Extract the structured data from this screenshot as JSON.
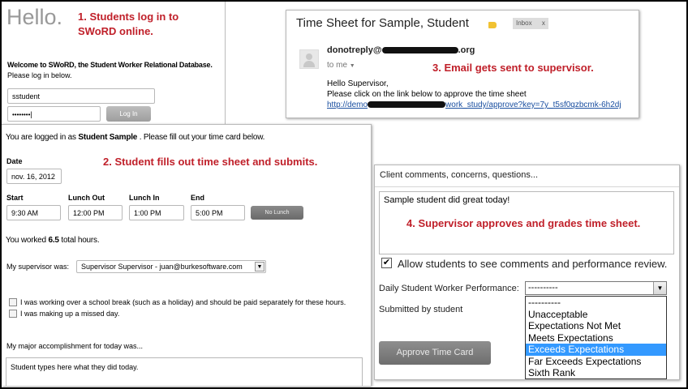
{
  "login": {
    "logo": "Hello.",
    "step": "1. Students log in to SWoRD online.",
    "welcome": "Welcome to SWoRD, the Student Worker Relational Database.",
    "instructions": "Please log in below.",
    "username_value": "sstudent",
    "password_value": "••••••••",
    "login_button": "Log In"
  },
  "email": {
    "subject": "Time Sheet for Sample, Student",
    "label": "Inbox",
    "label_close": "x",
    "sender": "donotreply@",
    "sender_domain": ".org",
    "to": "to me",
    "step": "3. Email gets sent to supervisor.",
    "greeting": "Hello Supervisor,",
    "body": "Please click on the link below to approve the time sheet",
    "link_start": "http://demo",
    "link_end": "work_study/approve?key=7y_t5sf0qzbcmk-6h2dj"
  },
  "timesheet": {
    "logged_in_prefix": "You are logged in as ",
    "student_name": "Student Sample",
    "logged_in_suffix": " . Please fill out your time card below.",
    "step": "2. Student fills out time sheet and submits.",
    "date_label": "Date",
    "date_value": "nov. 16, 2012",
    "start_label": "Start",
    "start_value": "9:30 AM",
    "lunch_out_label": "Lunch Out",
    "lunch_out_value": "12:00 PM",
    "lunch_in_label": "Lunch In",
    "lunch_in_value": "1:00 PM",
    "end_label": "End",
    "end_value": "5:00 PM",
    "no_lunch_button": "No Lunch",
    "worked_prefix": "You worked ",
    "worked_hours": "6.5",
    "worked_suffix": " total hours.",
    "supervisor_label": "My supervisor was:",
    "supervisor_value": "Supervisor Supervisor - juan@burkesoftware.com",
    "break_check_label": "I was working over a school break (such as a holiday) and should be paid separately for these hours.",
    "missed_day_label": "I was making up a missed day.",
    "accomplishment_label": "My major accomplishment for today was...",
    "accomplishment_value": "Student types here what they did today."
  },
  "approval": {
    "comments_label": "Client comments, concerns, questions...",
    "comment_value": "Sample student did great today!",
    "step": "4. Supervisor approves and grades time sheet.",
    "allow_label": "Allow students to see comments and performance review.",
    "allow_checked": true,
    "performance_label": "Daily Student Worker Performance:",
    "performance_selected": "----------",
    "submitted_label": "Submitted by student",
    "approve_button": "Approve Time Card",
    "options": [
      "----------",
      "Unacceptable",
      "Expectations Not Met",
      "Meets Expectations",
      "Exceeds Expectations",
      "Far Exceeds Expectations",
      "Sixth Rank"
    ],
    "highlighted_option": "Exceeds Expectations",
    "highlight_color": "#3399ff"
  },
  "colors": {
    "annotation": "#c0202a",
    "link": "#1a4fa0"
  }
}
